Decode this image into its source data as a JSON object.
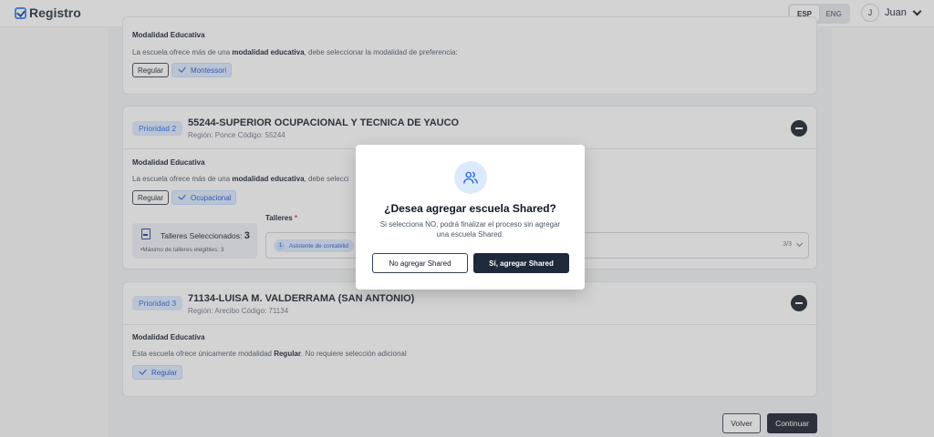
{
  "header": {
    "logo_text": "Registro",
    "lang": {
      "esp": "ESP",
      "eng": "ENG",
      "active": "ESP"
    },
    "user": {
      "initial": "J",
      "name": "Juan"
    }
  },
  "cards": [
    {
      "section_title": "Modalidad Educativa",
      "section_text_pre": "La escuela ofrece más de una ",
      "section_text_bold": "modalidad educativa",
      "section_text_post": ", debe seleccionar la modalidad de preferencia:",
      "options": [
        "Regular",
        "Montessori"
      ]
    },
    {
      "priority": "Prioridad 2",
      "name": "55244-SUPERIOR OCUPACIONAL Y TECNICA DE YAUCO",
      "sub": "Región: Ponce Código: 55244",
      "section_title": "Modalidad Educativa",
      "section_text_pre": "La escuela ofrece más de una ",
      "section_text_bold": "modalidad educativa",
      "section_text_post": ", debe selecci",
      "options": [
        "Regular",
        "Ocupacional"
      ],
      "talleres": {
        "selected_label": "Talleres Seleccionados:",
        "selected_count": "3",
        "max_text": "Máximo de talleres elegibles: 3",
        "field_label": "Talleres",
        "tag_num": "1",
        "tag_text": "Asistente de contabilid",
        "count": "3/3"
      }
    },
    {
      "priority": "Prioridad 3",
      "name": "71134-LUISA M. VALDERRAMA (SAN ANTONIO)",
      "sub": "Región: Arecibo Código: 71134",
      "section_title": "Modalidad Educativa",
      "section_text_pre": "Esta escuela ofrece únicamente modalidad ",
      "section_text_bold": "Regular",
      "section_text_post": ". No requiere selección adicional",
      "options": [
        "Regular"
      ]
    }
  ],
  "footer": {
    "back": "Volver",
    "continue": "Continuar"
  },
  "modal": {
    "icon": "users-icon",
    "title": "¿Desea agregar escuela Shared?",
    "text": "Si selecciona NO, podrá finalizar el proceso sin agregar una escuela Shared.",
    "no_button": "No agregar Shared",
    "yes_button": "Sí, agregar Shared"
  },
  "colors": {
    "accent": "#2563eb",
    "dark": "#111827",
    "chip_bg": "#dbeafe"
  }
}
